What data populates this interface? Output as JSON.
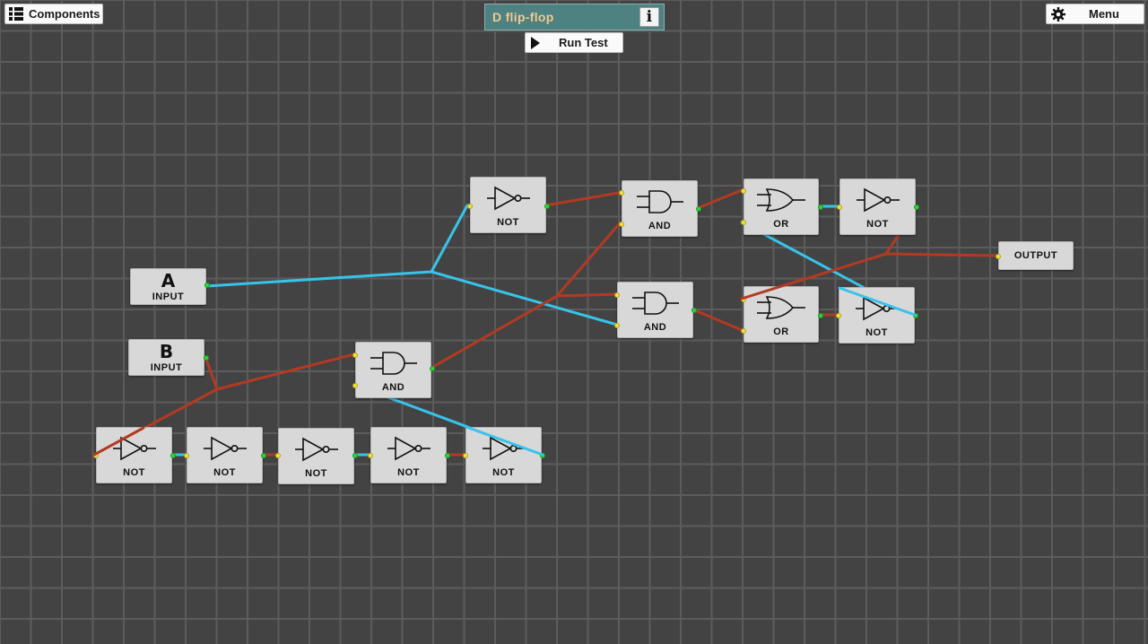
{
  "toolbar": {
    "components_label": "Components",
    "menu_label": "Menu",
    "title": "D flip-flop",
    "info_icon": "i",
    "run_label": "Run Test"
  },
  "colors": {
    "wire_on": "#38c3ea",
    "wire_off": "#b23a22",
    "title_bg": "#4e8182",
    "title_text": "#f3c98f",
    "grid_line": "#5c5c5c",
    "background": "#434343"
  },
  "components": {
    "input_a": {
      "letter": "A",
      "label": "INPUT"
    },
    "input_b": {
      "letter": "B",
      "label": "INPUT"
    },
    "output": {
      "label": "OUTPUT"
    },
    "not_top": {
      "label": "NOT"
    },
    "and_top": {
      "label": "AND"
    },
    "and_mid": {
      "label": "AND"
    },
    "and_low": {
      "label": "AND"
    },
    "or_top": {
      "label": "OR"
    },
    "or_mid": {
      "label": "OR"
    },
    "not_or_top": {
      "label": "NOT"
    },
    "not_or_mid": {
      "label": "NOT"
    },
    "not_chain_1": {
      "label": "NOT"
    },
    "not_chain_2": {
      "label": "NOT"
    },
    "not_chain_3": {
      "label": "NOT"
    },
    "not_chain_4": {
      "label": "NOT"
    },
    "not_chain_5": {
      "label": "NOT"
    }
  }
}
